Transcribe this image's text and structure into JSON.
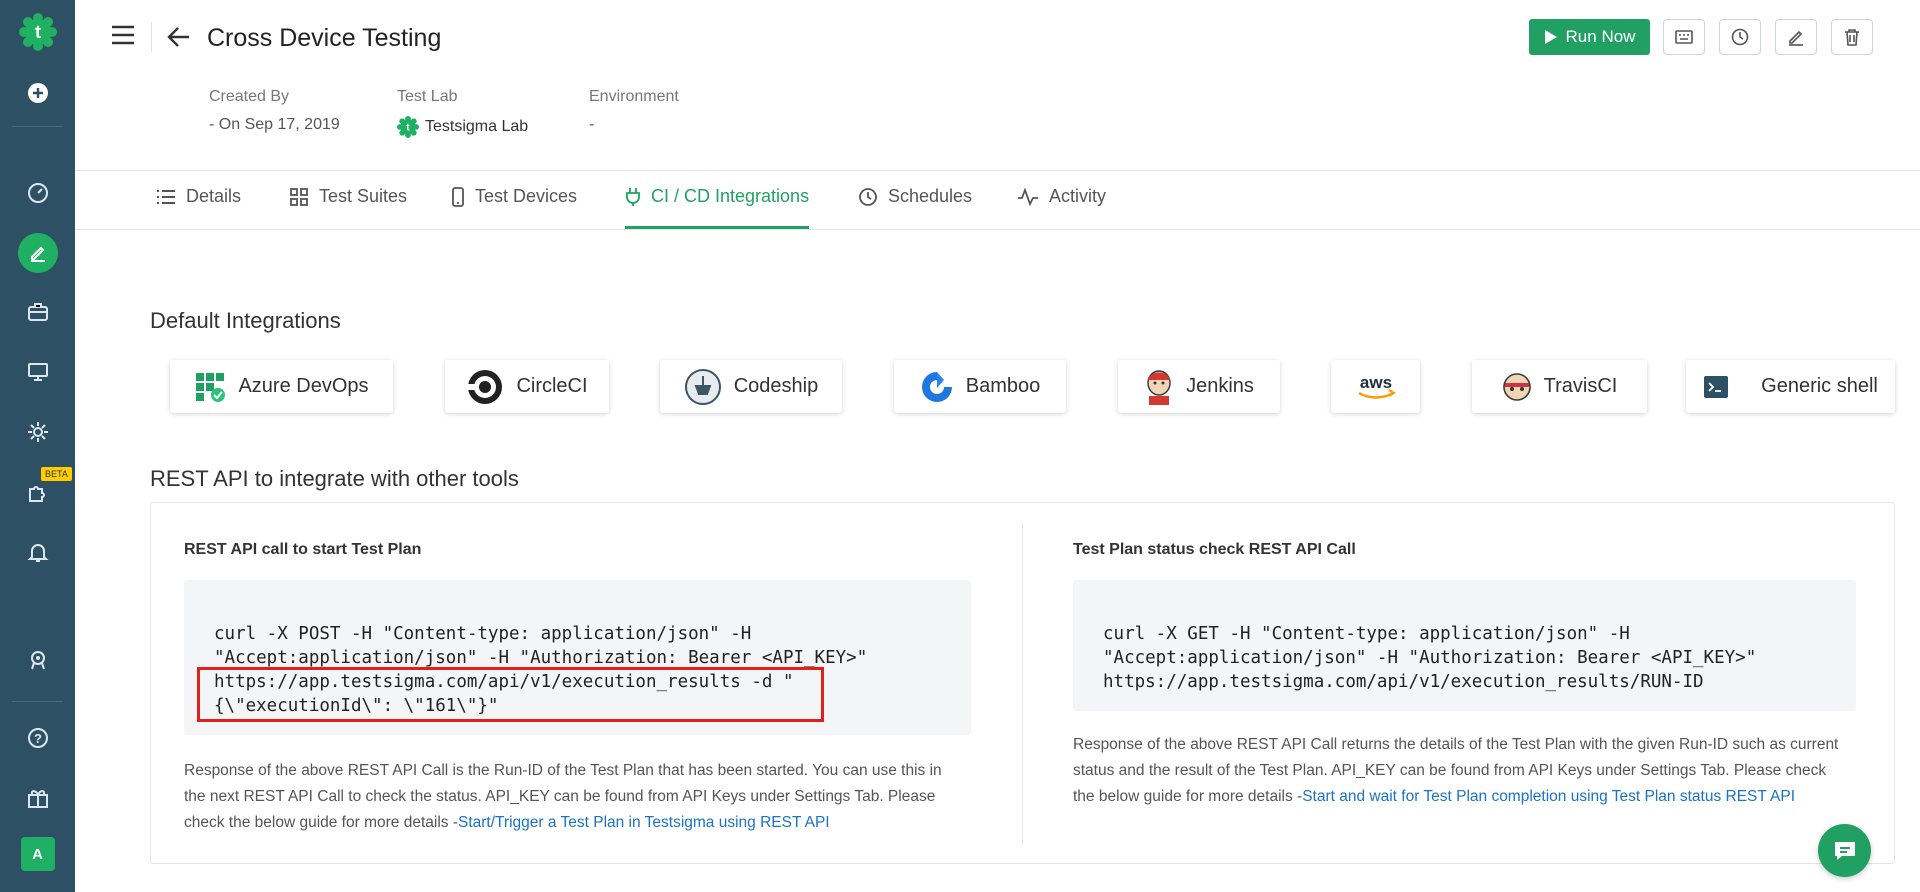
{
  "sidebar": {
    "logo_icon": "testsigma-logo-icon",
    "beta_label": "BETA",
    "avatar_initial": "A",
    "colors": {
      "background": "#2e5064",
      "active": "#20b063"
    }
  },
  "header": {
    "title": "Cross Device Testing",
    "run_now_label": "Run Now",
    "created_by_label": "Created By",
    "created_by_value": "- On Sep 17, 2019",
    "test_lab_label": "Test Lab",
    "test_lab_value": "Testsigma Lab",
    "environment_label": "Environment",
    "environment_value": "-"
  },
  "tabs": [
    {
      "label": "Details",
      "icon": "list-icon"
    },
    {
      "label": "Test Suites",
      "icon": "grid-icon"
    },
    {
      "label": "Test Devices",
      "icon": "mobile-icon"
    },
    {
      "label": "CI / CD Integrations",
      "icon": "plug-icon",
      "active": true
    },
    {
      "label": "Schedules",
      "icon": "clock-icon"
    },
    {
      "label": "Activity",
      "icon": "activity-icon"
    }
  ],
  "integrations": {
    "title": "Default Integrations",
    "items": [
      {
        "label": "Azure DevOps",
        "icon": "azure-devops-icon"
      },
      {
        "label": "CircleCI",
        "icon": "circleci-icon"
      },
      {
        "label": "Codeship",
        "icon": "codeship-icon"
      },
      {
        "label": "Bamboo",
        "icon": "bamboo-icon"
      },
      {
        "label": "Jenkins",
        "icon": "jenkins-icon"
      },
      {
        "label": "aws",
        "icon": "aws-icon"
      },
      {
        "label": "TravisCI",
        "icon": "travisci-icon"
      },
      {
        "label": "Generic shell",
        "icon": "shell-icon"
      }
    ]
  },
  "rest": {
    "title": "REST API to integrate with other tools",
    "start": {
      "title": "REST API call to start Test Plan",
      "code": [
        "curl -X POST -H \"Content-type: application/json\" -H",
        "\"Accept:application/json\" -H \"Authorization: Bearer <API_KEY>\"",
        "https://app.testsigma.com/api/v1/execution_results -d \"",
        "{\\\"executionId\\\": \\\"161\\\"}\""
      ],
      "desc_lines": [
        "Response of the above REST API Call is the Run-ID of the Test Plan that has been started. You can use this in",
        "the next REST API Call to check the status. API_KEY can be found from API Keys under Settings Tab. Please",
        "check the below guide for more details -"
      ],
      "link": "Start/Trigger a Test Plan in Testsigma using REST API"
    },
    "status": {
      "title": "Test Plan status check REST API Call",
      "code": [
        "curl -X GET -H \"Content-type: application/json\" -H",
        "\"Accept:application/json\" -H \"Authorization: Bearer <API_KEY>\"",
        "https://app.testsigma.com/api/v1/execution_results/RUN-ID"
      ],
      "desc_lines": [
        "Response of the above REST API Call returns the details of the Test Plan with the given Run-ID such as current",
        "status and the result of the Test Plan. API_KEY can be found from API Keys under Settings Tab. Please check",
        "the below guide for more details -"
      ],
      "link": "Start and wait for Test Plan completion using Test Plan status REST API"
    }
  },
  "colors": {
    "accent": "#20a163",
    "link": "#1a73c8",
    "highlight": "#e02020"
  }
}
